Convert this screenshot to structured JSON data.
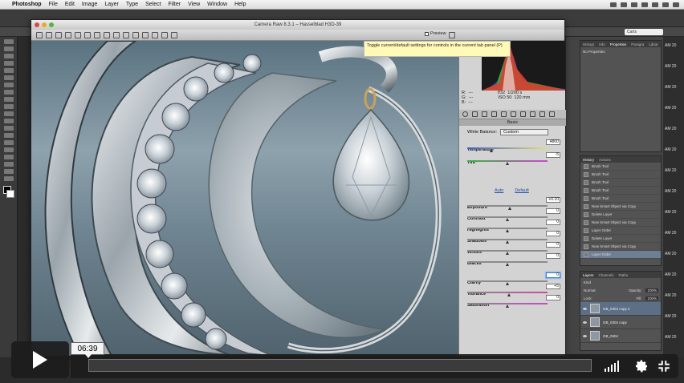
{
  "menubar": {
    "apple": "",
    "app": "Photoshop",
    "items": [
      "File",
      "Edit",
      "Image",
      "Layer",
      "Type",
      "Select",
      "Filter",
      "View",
      "Window",
      "Help"
    ]
  },
  "workspace": {
    "search": "Carts"
  },
  "camera_raw": {
    "title": "Camera Raw 8.3.1  –  Hasselblad H3D-39",
    "preview_label": "Preview",
    "tooltip": "Toggle current/default settings for controls in the current tab panel (P)",
    "readout": {
      "r": "R:",
      "g": "G:",
      "b": "B:",
      "dash": "---",
      "aperture": "f/32",
      "shutter": "1/200 s",
      "iso": "ISO 50",
      "focal": "120 mm"
    },
    "panel_title": "Basic",
    "white_balance_label": "White Balance:",
    "white_balance_value": "Custom",
    "auto_label": "Auto",
    "default_label": "Default",
    "sliders": [
      {
        "label": "Temperature",
        "value": "4800"
      },
      {
        "label": "Tint",
        "value": "-5"
      },
      {
        "label": "Exposure",
        "value": "+0.10"
      },
      {
        "label": "Contrast",
        "value": "0"
      },
      {
        "label": "Highlights",
        "value": "0"
      },
      {
        "label": "Shadows",
        "value": "0"
      },
      {
        "label": "Whites",
        "value": "0"
      },
      {
        "label": "Blacks",
        "value": "0"
      },
      {
        "label": "Clarity",
        "value": "0"
      },
      {
        "label": "Vibrance",
        "value": "+5"
      },
      {
        "label": "Saturation",
        "value": "0"
      }
    ]
  },
  "panels": {
    "props_tabs": [
      "Histogr",
      "Info",
      "Properties",
      "Paragra",
      "Librar"
    ],
    "props_body": "No Properties",
    "history_tabs": [
      "History",
      "Actions"
    ],
    "history_items": [
      "Brush Tool",
      "Brush Tool",
      "Brush Tool",
      "Brush Tool",
      "Brush Tool",
      "New Smart Object via Copy",
      "Delete Layer",
      "New Smart Object via Copy",
      "Layer Order",
      "Delete Layer",
      "New Smart Object via Copy",
      "Layer Order"
    ],
    "layers_tabs": [
      "Layers",
      "Channels",
      "Paths"
    ],
    "layers_kind": "Kind",
    "blend_mode": "Normal",
    "opacity_label": "Opacity:",
    "opacity_value": "100%",
    "lock_label": "Lock:",
    "fill_label": "Fill:",
    "fill_value": "100%",
    "layers": [
      {
        "name": "GB_0304 copy 2",
        "selected": true
      },
      {
        "name": "GB_0304 copy",
        "selected": false
      },
      {
        "name": "GB_0304",
        "selected": false
      }
    ],
    "side_labels": [
      "AM",
      "AM",
      "AM",
      "AM",
      "AM",
      "AM",
      "AM",
      "AM",
      "AM",
      "AM",
      "AM",
      "AM",
      "AM",
      "AM",
      "AM"
    ],
    "side_suffix": "20"
  },
  "video": {
    "time": "06:39",
    "progress_fraction": 0.0,
    "volume_bars": 5
  },
  "colors": {
    "accent": "#3a7bd5",
    "player_bg": "#1c1c1c"
  }
}
